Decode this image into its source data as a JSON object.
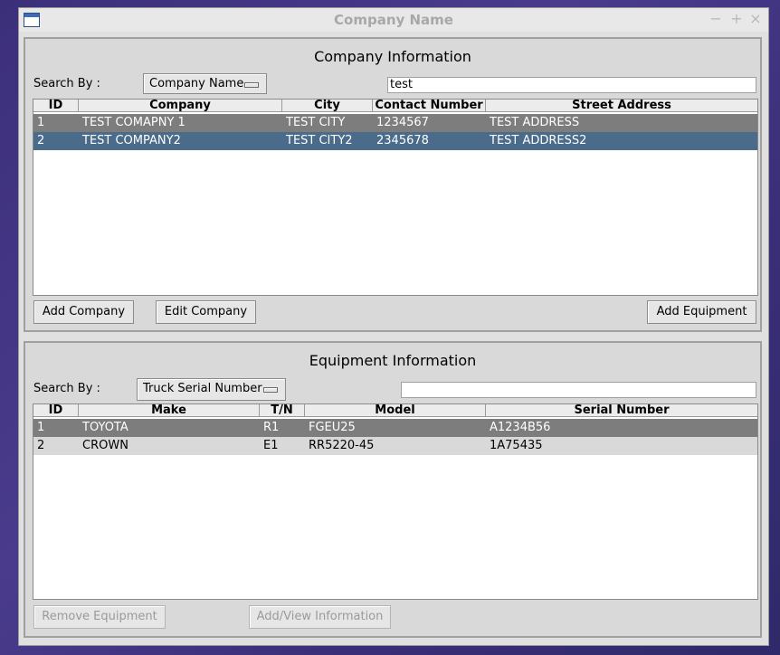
{
  "window": {
    "title": "Company Name",
    "controls": [
      "−",
      "+",
      "×"
    ]
  },
  "company_panel": {
    "title": "Company Information",
    "search_label": "Search By :",
    "search_by": "Company Name",
    "search_value": "test",
    "columns": [
      "ID",
      "Company",
      "City",
      "Contact Number",
      "Street Address"
    ],
    "rows": [
      {
        "id": "1",
        "company": "TEST COMAPNY 1",
        "city": "TEST CITY",
        "contact": "1234567",
        "address": "TEST ADDRESS"
      },
      {
        "id": "2",
        "company": "TEST COMPANY2",
        "city": "TEST CITY2",
        "contact": "2345678",
        "address": "TEST ADDRESS2"
      }
    ],
    "buttons": {
      "add_company": "Add Company",
      "edit_company": "Edit Company",
      "add_equipment": "Add Equipment"
    }
  },
  "equipment_panel": {
    "title": "Equipment Information",
    "search_label": "Search By :",
    "search_by": "Truck Serial Number",
    "search_value": "",
    "columns": [
      "ID",
      "Make",
      "T/N",
      "Model",
      "Serial Number"
    ],
    "rows": [
      {
        "id": "1",
        "make": "TOYOTA",
        "tn": "R1",
        "model": "FGEU25",
        "serial": "A1234B56"
      },
      {
        "id": "2",
        "make": "CROWN",
        "tn": "E1",
        "model": "RR5220-45",
        "serial": "1A75435"
      }
    ],
    "buttons": {
      "remove_equipment": "Remove Equipment",
      "add_view_information": "Add/View Information"
    }
  }
}
